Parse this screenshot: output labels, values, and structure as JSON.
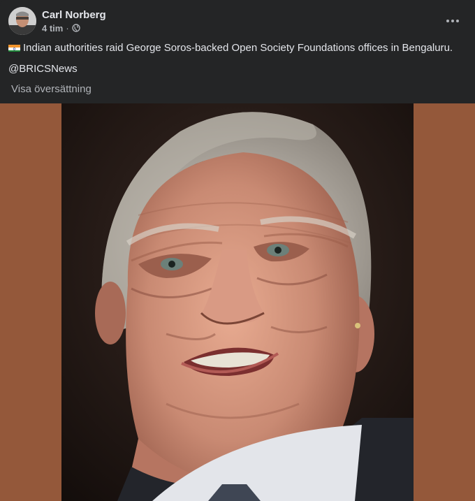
{
  "post": {
    "author": "Carl Norberg",
    "time": "4 tim",
    "separator": "·",
    "audience_icon": "globe-icon",
    "text": "Indian authorities raid George Soros-backed Open Society Foundations offices in Bengaluru.",
    "mention": "@BRICSNews",
    "translate_label": "Visa översättning",
    "flag_emoji": "india-flag-emoji"
  },
  "colors": {
    "background": "#242526",
    "text_primary": "#e4e6eb",
    "text_secondary": "#b0b3b8",
    "image_backdrop": "#94583a"
  }
}
